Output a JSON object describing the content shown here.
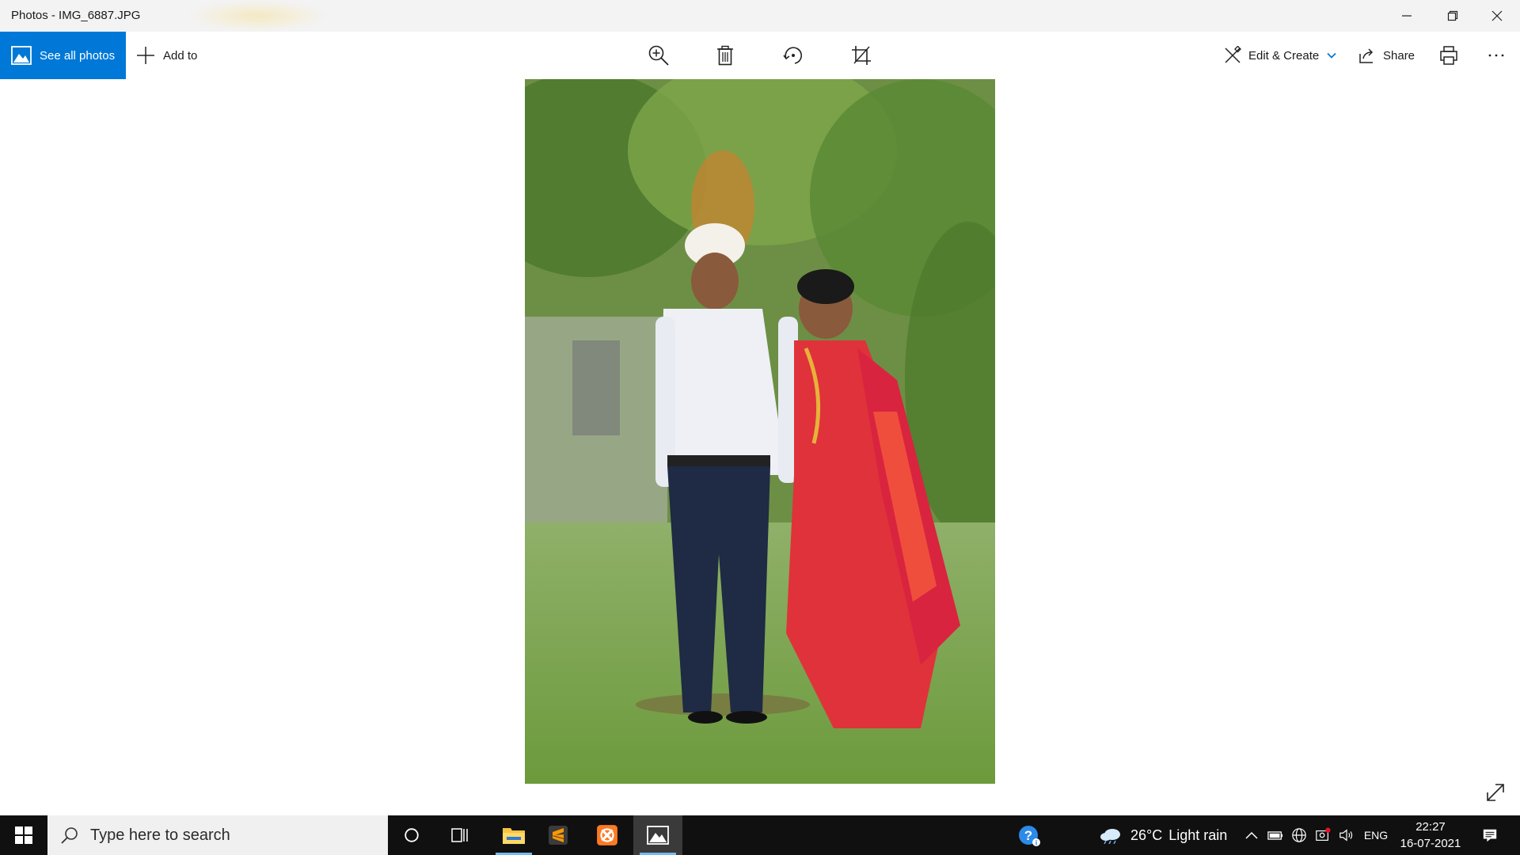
{
  "window": {
    "title": "Photos - IMG_6887.JPG",
    "controls": {
      "minimize": "minimize-icon",
      "restore": "restore-icon",
      "close": "close-icon"
    }
  },
  "toolbar": {
    "see_all_label": "See all photos",
    "add_to_label": "Add to",
    "center_tools": [
      "zoom-in-icon",
      "delete-icon",
      "rotate-icon",
      "crop-icon"
    ],
    "edit_create_label": "Edit & Create",
    "share_label": "Share",
    "print": "print-icon",
    "more": "more-icon",
    "accent_color": "#0078d7"
  },
  "photo": {
    "description_icon": "photo-image"
  },
  "taskbar": {
    "search_placeholder": "Type here to search",
    "weather": {
      "temp": "26°C",
      "condition": "Light rain"
    },
    "language": "ENG",
    "time": "22:27",
    "date": "16-07-2021",
    "active_indicator_color": "#76b9ed"
  }
}
